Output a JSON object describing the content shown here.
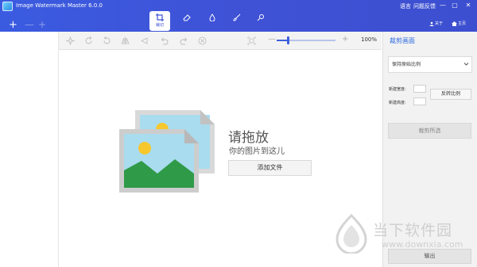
{
  "window": {
    "title": "Image Watermark Master 6.0.0",
    "links": {
      "language": "语言",
      "feedback": "问题反馈"
    },
    "controls": {
      "minimize": "—",
      "maximize": "▢",
      "close": "✕"
    }
  },
  "nav": {
    "about": "关于",
    "home": "主页"
  },
  "mode_tabs": [
    {
      "name": "crop",
      "label": "裁切",
      "active": true
    },
    {
      "name": "eraser",
      "active": false
    },
    {
      "name": "drop",
      "active": false
    },
    {
      "name": "brush",
      "active": false
    },
    {
      "name": "pin",
      "active": false
    }
  ],
  "file_buttons": {
    "add": "+",
    "remove": "—",
    "add2": "+"
  },
  "toolbar": {
    "zoom_percent": "100%",
    "zoom_minus": "—",
    "zoom_plus": "+",
    "zoom_level": 0.2
  },
  "canvas": {
    "drop_title": "请拖放",
    "drop_subtitle": "你的图片到这儿",
    "add_file_button": "添加文件"
  },
  "crop_panel": {
    "title": "裁剪画面",
    "ratio_select": "保持原始比例",
    "new_width_label": "新建宽度:",
    "new_height_label": "新建高度:",
    "new_width_value": "",
    "new_height_value": "",
    "swap_ratio_button": "反转比例",
    "crop_selected_button": "裁剪所选",
    "output_button": "输出"
  },
  "watermark": {
    "text": "当下软件园",
    "url": "www.downxia.com"
  },
  "colors": {
    "titlebar": "#3d52d5",
    "accent": "#2c6be0",
    "photo_sky": "#a8ddf0",
    "photo_sun": "#f7c72e",
    "photo_hill": "#2f9a48"
  }
}
